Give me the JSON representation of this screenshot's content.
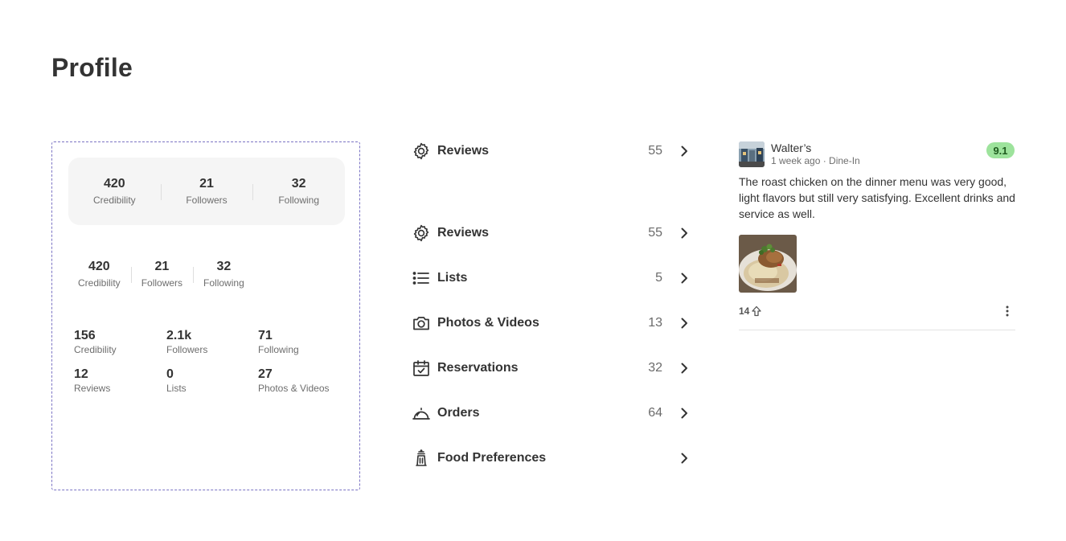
{
  "page": {
    "title": "Profile"
  },
  "stats_card": [
    {
      "value": "420",
      "label": "Credibility"
    },
    {
      "value": "21",
      "label": "Followers"
    },
    {
      "value": "32",
      "label": "Following"
    }
  ],
  "stats_inline": [
    {
      "value": "420",
      "label": "Credibility"
    },
    {
      "value": "21",
      "label": "Followers"
    },
    {
      "value": "32",
      "label": "Following"
    }
  ],
  "stats_grid": [
    {
      "value": "156",
      "label": "Credibility"
    },
    {
      "value": "2.1k",
      "label": "Followers"
    },
    {
      "value": "71",
      "label": "Following"
    },
    {
      "value": "12",
      "label": "Reviews"
    },
    {
      "value": "0",
      "label": "Lists"
    },
    {
      "value": "27",
      "label": "Photos & Videos"
    }
  ],
  "menu": [
    {
      "icon": "gear-icon",
      "label": "Reviews",
      "count": "55"
    },
    {
      "icon": "gear-icon",
      "label": "Reviews",
      "count": "55"
    },
    {
      "icon": "list-icon",
      "label": "Lists",
      "count": "5"
    },
    {
      "icon": "camera-icon",
      "label": "Photos & Videos",
      "count": "13"
    },
    {
      "icon": "calendar-check-icon",
      "label": "Reservations",
      "count": "32"
    },
    {
      "icon": "cloche-icon",
      "label": "Orders",
      "count": "64"
    },
    {
      "icon": "pepper-shaker-icon",
      "label": "Food Preferences",
      "count": ""
    }
  ],
  "review": {
    "business": "Walter’s",
    "meta": "1 week ago · Dine-In",
    "score": "9.1",
    "text": "The roast chicken on the dinner menu was very good, light flavors but still very satisfying. Excellent drinks and service as well.",
    "likes": "14"
  },
  "colors": {
    "frame_border": "#7b74c4",
    "score_bg": "#9de39c",
    "card_bg": "#f5f5f5"
  }
}
